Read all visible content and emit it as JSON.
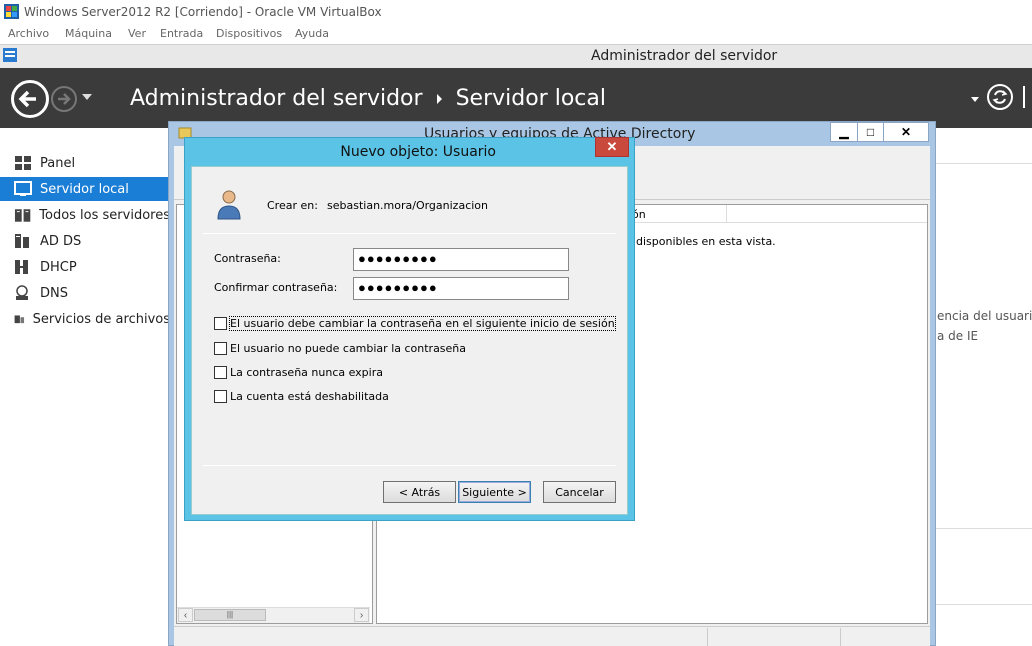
{
  "vbox": {
    "title": "Windows Server2012 R2 [Corriendo] - Oracle VM VirtualBox",
    "menu": [
      "Archivo",
      "Máquina",
      "Ver",
      "Entrada",
      "Dispositivos",
      "Ayuda"
    ]
  },
  "server_manager": {
    "window_title": "Administrador del servidor",
    "breadcrumb": {
      "root": "Administrador del servidor",
      "current": "Servidor local"
    },
    "sidebar": {
      "items": [
        {
          "label": "Panel",
          "icon": "dashboard-icon"
        },
        {
          "label": "Servidor local",
          "icon": "server-icon",
          "active": true
        },
        {
          "label": "Todos los servidores",
          "icon": "servers-icon"
        },
        {
          "label": "AD DS",
          "icon": "ad-ds-icon"
        },
        {
          "label": "DHCP",
          "icon": "dhcp-icon"
        },
        {
          "label": "DNS",
          "icon": "dns-icon"
        },
        {
          "label": "Servicios de archivos",
          "icon": "file-services-icon"
        }
      ]
    },
    "right_panel": {
      "line1": "encia del usuario",
      "line2": "a de IE"
    }
  },
  "ad_window": {
    "title": "Usuarios y equipos de Active Directory",
    "column_header": "ón",
    "empty_message": "disponibles en esta vista.",
    "controls": {
      "minimize": "▁",
      "maximize": "□",
      "close": "✕"
    }
  },
  "dialog": {
    "title": "Nuevo objeto: Usuario",
    "create_in_label": "Crear en:",
    "create_in_value": "sebastian.mora/Organizacion",
    "password_label": "Contraseña:",
    "password_value": "●●●●●●●●●",
    "confirm_label": "Confirmar contraseña:",
    "confirm_value": "●●●●●●●●●",
    "checkboxes": [
      {
        "label": "El usuario debe cambiar la contraseña en el siguiente inicio de sesión",
        "checked": false
      },
      {
        "label": "El usuario no puede cambiar la contraseña",
        "checked": false
      },
      {
        "label": "La contraseña nunca expira",
        "checked": false
      },
      {
        "label": "La cuenta está deshabilitada",
        "checked": false
      }
    ],
    "buttons": {
      "back": "< Atrás",
      "next": "Siguiente >",
      "cancel": "Cancelar"
    }
  },
  "colors": {
    "header_bg": "#3b3b3b",
    "sidebar_active": "#1a7ed6",
    "dialog_frame": "#5bc3e6",
    "close_button": "#c94a3c"
  }
}
